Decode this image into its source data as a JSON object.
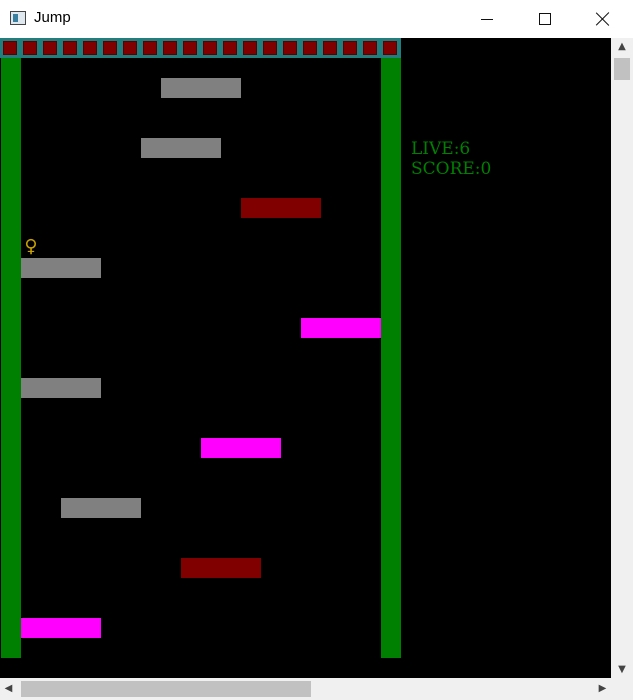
{
  "window": {
    "title": "Jump",
    "minimize_glyph": "minimize-icon",
    "maximize_glyph": "maximize-icon",
    "close_glyph": "close-icon"
  },
  "colors": {
    "ceiling": "#1f7f7f",
    "spike": "#800000",
    "wall": "#008000",
    "platform_normal": "#808080",
    "platform_fragile": "#800000",
    "platform_bounce": "#ff00ff",
    "hud_text": "#008000",
    "player": "#c8a000"
  },
  "game": {
    "player_glyph": "♀",
    "hud": {
      "lives": "LIVE:6",
      "score": "SCORE:0"
    },
    "spike_count": 20,
    "platforms": [
      {
        "type": "normal",
        "col": 8,
        "row": 2
      },
      {
        "type": "normal",
        "col": 7,
        "row": 5
      },
      {
        "type": "fragile",
        "col": 12,
        "row": 8
      },
      {
        "type": "normal",
        "col": 1,
        "row": 11
      },
      {
        "type": "bounce",
        "col": 15,
        "row": 14
      },
      {
        "type": "normal",
        "col": 1,
        "row": 17
      },
      {
        "type": "bounce",
        "col": 10,
        "row": 20
      },
      {
        "type": "normal",
        "col": 3,
        "row": 23
      },
      {
        "type": "fragile",
        "col": 9,
        "row": 26
      },
      {
        "type": "bounce",
        "col": 1,
        "row": 29
      }
    ]
  },
  "scrollbars": {
    "up_arrow": "▲",
    "down_arrow": "▼",
    "left_arrow": "◀",
    "right_arrow": "▶"
  }
}
